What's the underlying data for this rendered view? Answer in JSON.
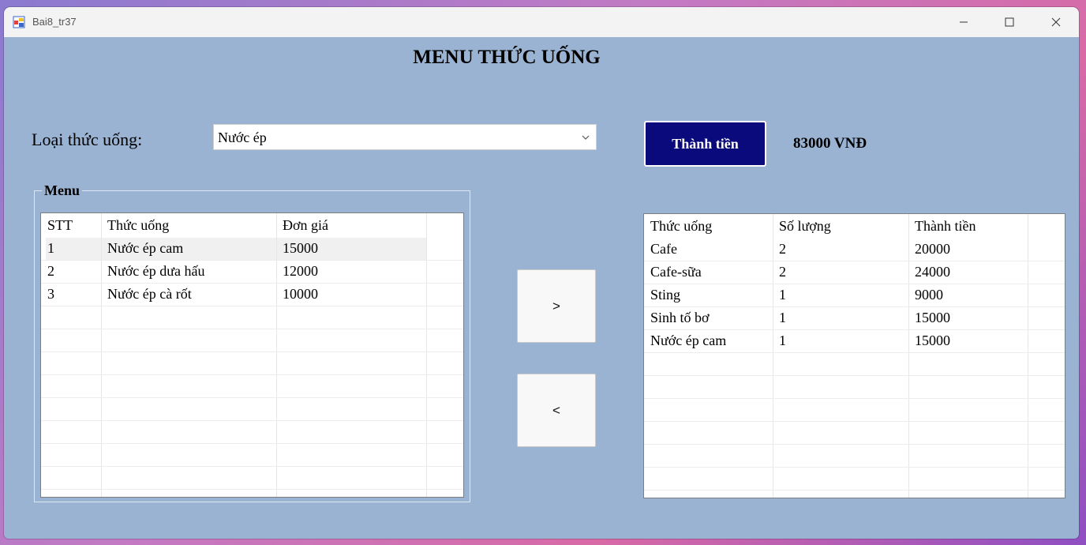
{
  "window": {
    "title": "Bai8_tr37"
  },
  "form": {
    "heading": "MENU THỨC UỐNG",
    "drink_type_label": "Loại thức uống:",
    "drink_type_selected": "Nước ép",
    "calc_button": "Thành tiền",
    "total": "83000 VNĐ",
    "add_button": ">",
    "remove_button": "<"
  },
  "menu": {
    "group_title": "Menu",
    "columns": [
      "STT",
      "Thức uống",
      "Đơn giá"
    ],
    "rows": [
      [
        "1",
        "Nước ép cam",
        "15000"
      ],
      [
        "2",
        "Nước ép dưa hấu",
        "12000"
      ],
      [
        "3",
        "Nước ép cà rốt",
        "10000"
      ]
    ]
  },
  "order": {
    "columns": [
      "Thức uống",
      "Số lượng",
      "Thành tiền"
    ],
    "rows": [
      [
        "Cafe",
        "2",
        "20000"
      ],
      [
        "Cafe-sữa",
        "2",
        "24000"
      ],
      [
        "Sting",
        "1",
        "9000"
      ],
      [
        "Sinh tố bơ",
        "1",
        "15000"
      ],
      [
        "Nước ép cam",
        "1",
        "15000"
      ]
    ]
  }
}
